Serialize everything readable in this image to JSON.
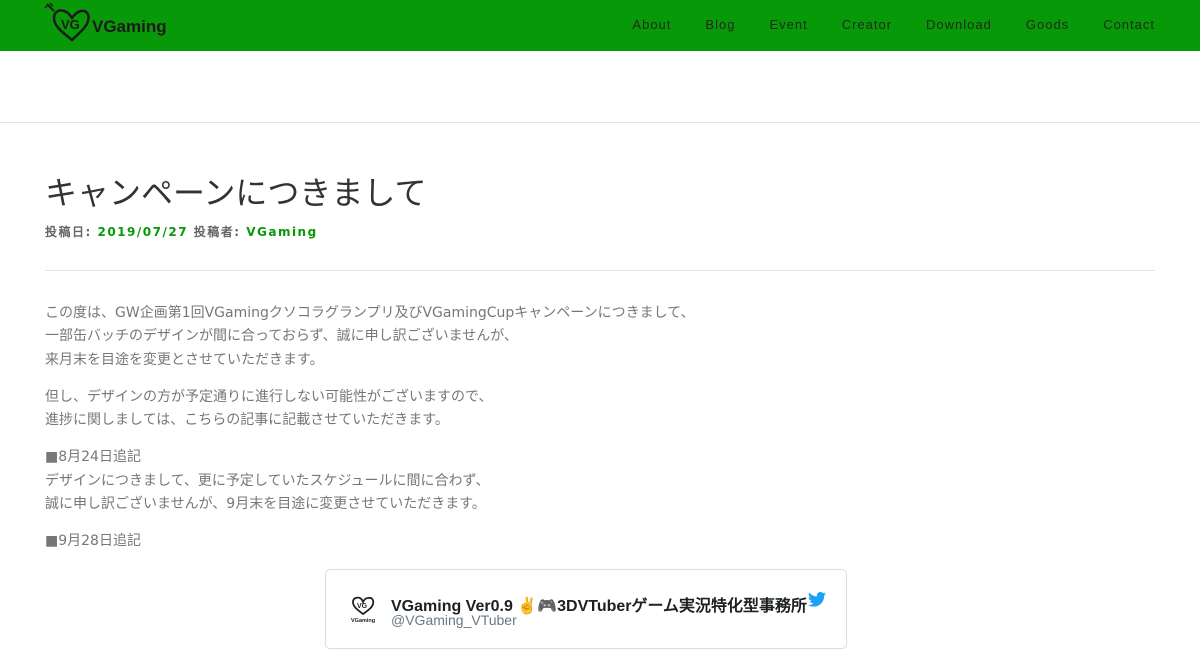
{
  "header": {
    "brand": "VGaming",
    "nav": [
      "About",
      "Blog",
      "Event",
      "Creator",
      "Download",
      "Goods",
      "Contact"
    ],
    "colors": {
      "header_bg": "#079907",
      "link": "#079907"
    }
  },
  "post": {
    "title": "キャンペーンにつきまして",
    "date_label": "投稿日: ",
    "date": "2019/07/27",
    "author_label": " 投稿者: ",
    "author": "VGaming"
  },
  "body": {
    "p1": [
      "この度は、GW企画第1回VGamingクソコラグランプリ及びVGamingCupキャンペーンにつきまして、",
      "一部缶バッチのデザインが間に合っておらず、誠に申し訳ございませんが、",
      "来月末を目途を変更とさせていただきます。"
    ],
    "p2": [
      "但し、デザインの方が予定通りに進行しない可能性がございますので、",
      "進捗に関しましては、こちらの記事に記載させていただきます。"
    ],
    "p3": [
      "■8月24日追記",
      "デザインにつきまして、更に予定していたスケジュールに間に合わず、",
      "誠に申し訳ございませんが、9月末を目途に変更させていただきます。"
    ],
    "p4": [
      "■9月28日追記"
    ]
  },
  "tweet": {
    "name": "VGaming Ver0.9 ✌🎮3DVTuberゲーム実況特化型事務所",
    "handle": "@VGaming_VTuber",
    "avatar_text": "VGaming",
    "icons": [
      "vgaming-logo-icon",
      "twitter-bird-icon"
    ]
  }
}
